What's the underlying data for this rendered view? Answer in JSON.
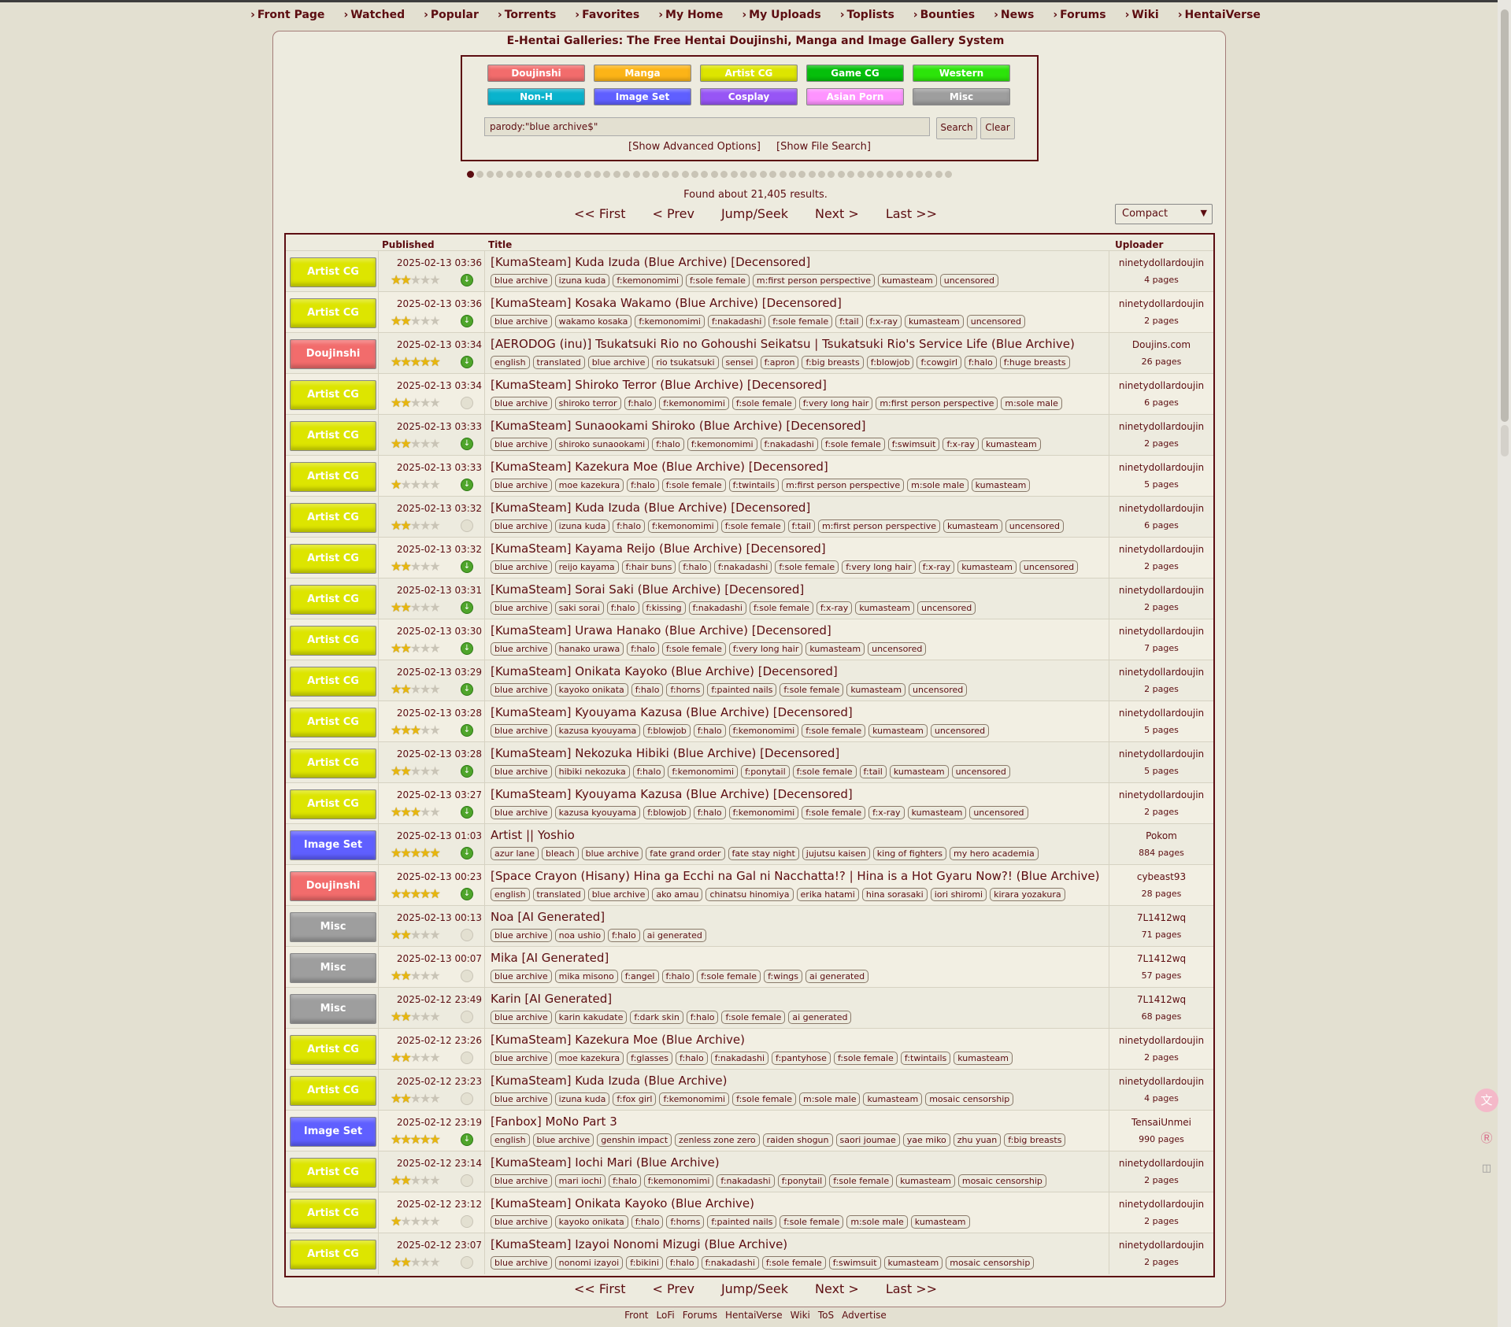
{
  "nav": [
    "Front Page",
    "Watched",
    "Popular",
    "Torrents",
    "Favorites",
    "My Home",
    "My Uploads",
    "Toplists",
    "Bounties",
    "News",
    "Forums",
    "Wiki",
    "HentaiVerse"
  ],
  "page_title": "E-Hentai Galleries: The Free Hentai Doujinshi, Manga and Image Gallery System",
  "categories": [
    {
      "label": "Doujinshi",
      "color": "#f26c6c"
    },
    {
      "label": "Manga",
      "color": "#fcb417"
    },
    {
      "label": "Artist CG",
      "color": "#dde500"
    },
    {
      "label": "Game CG",
      "color": "#05bf0b"
    },
    {
      "label": "Western",
      "color": "#2ce40a"
    },
    {
      "label": "Non-H",
      "color": "#09b3cd"
    },
    {
      "label": "Image Set",
      "color": "#5f5fff"
    },
    {
      "label": "Cosplay",
      "color": "#9755f5"
    },
    {
      "label": "Asian Porn",
      "color": "#fe93ff"
    },
    {
      "label": "Misc",
      "color": "#9e9e9e"
    }
  ],
  "search": {
    "value": "parody:\"blue archive$\"",
    "search_label": "Search",
    "clear_label": "Clear",
    "advanced": "[Show Advanced Options]",
    "file_search": "[Show File Search]"
  },
  "found": "Found about 21,405 results.",
  "pager": {
    "first": "<< First",
    "prev": "< Prev",
    "jump": "Jump/Seek",
    "next": "Next >",
    "last": "Last >>"
  },
  "view_mode": "Compact",
  "headers": {
    "published": "Published",
    "title": "Title",
    "uploader": "Uploader"
  },
  "rows": [
    {
      "cat": "Artist CG",
      "date": "2025-02-13 03:36",
      "stars": 2,
      "dl": true,
      "title": "[KumaSteam] Kuda Izuda (Blue Archive) [Decensored]",
      "tags": [
        "blue archive",
        "izuna kuda",
        "f:kemonomimi",
        "f:sole female",
        "m:first person perspective",
        "kumasteam",
        "uncensored"
      ],
      "uploader": "ninetydollardoujin",
      "pages": "4 pages"
    },
    {
      "cat": "Artist CG",
      "date": "2025-02-13 03:36",
      "stars": 2,
      "dl": true,
      "title": "[KumaSteam] Kosaka Wakamo (Blue Archive) [Decensored]",
      "tags": [
        "blue archive",
        "wakamo kosaka",
        "f:kemonomimi",
        "f:nakadashi",
        "f:sole female",
        "f:tail",
        "f:x-ray",
        "kumasteam",
        "uncensored"
      ],
      "uploader": "ninetydollardoujin",
      "pages": "2 pages"
    },
    {
      "cat": "Doujinshi",
      "date": "2025-02-13 03:34",
      "stars": 5,
      "dl": true,
      "title": "[AERODOG (inu)] Tsukatsuki Rio no Gohoushi Seikatsu | Tsukatsuki Rio's Service Life (Blue Archive)",
      "tags": [
        "english",
        "translated",
        "blue archive",
        "rio tsukatsuki",
        "sensei",
        "f:apron",
        "f:big breasts",
        "f:blowjob",
        "f:cowgirl",
        "f:halo",
        "f:huge breasts"
      ],
      "uploader": "Doujins.com",
      "pages": "26 pages"
    },
    {
      "cat": "Artist CG",
      "date": "2025-02-13 03:34",
      "stars": 2,
      "dl": false,
      "title": "[KumaSteam] Shiroko Terror (Blue Archive) [Decensored]",
      "tags": [
        "blue archive",
        "shiroko terror",
        "f:halo",
        "f:kemonomimi",
        "f:sole female",
        "f:very long hair",
        "m:first person perspective",
        "m:sole male"
      ],
      "uploader": "ninetydollardoujin",
      "pages": "6 pages"
    },
    {
      "cat": "Artist CG",
      "date": "2025-02-13 03:33",
      "stars": 2,
      "dl": true,
      "title": "[KumaSteam] Sunaookami Shiroko (Blue Archive) [Decensored]",
      "tags": [
        "blue archive",
        "shiroko sunaookami",
        "f:halo",
        "f:kemonomimi",
        "f:nakadashi",
        "f:sole female",
        "f:swimsuit",
        "f:x-ray",
        "kumasteam"
      ],
      "uploader": "ninetydollardoujin",
      "pages": "2 pages"
    },
    {
      "cat": "Artist CG",
      "date": "2025-02-13 03:33",
      "stars": 1,
      "dl": true,
      "title": "[KumaSteam] Kazekura Moe (Blue Archive) [Decensored]",
      "tags": [
        "blue archive",
        "moe kazekura",
        "f:halo",
        "f:sole female",
        "f:twintails",
        "m:first person perspective",
        "m:sole male",
        "kumasteam"
      ],
      "uploader": "ninetydollardoujin",
      "pages": "5 pages"
    },
    {
      "cat": "Artist CG",
      "date": "2025-02-13 03:32",
      "stars": 2,
      "dl": false,
      "title": "[KumaSteam] Kuda Izuda (Blue Archive) [Decensored]",
      "tags": [
        "blue archive",
        "izuna kuda",
        "f:halo",
        "f:kemonomimi",
        "f:sole female",
        "f:tail",
        "m:first person perspective",
        "kumasteam",
        "uncensored"
      ],
      "uploader": "ninetydollardoujin",
      "pages": "6 pages"
    },
    {
      "cat": "Artist CG",
      "date": "2025-02-13 03:32",
      "stars": 2,
      "dl": true,
      "title": "[KumaSteam] Kayama Reijo (Blue Archive) [Decensored]",
      "tags": [
        "blue archive",
        "reijo kayama",
        "f:hair buns",
        "f:halo",
        "f:nakadashi",
        "f:sole female",
        "f:very long hair",
        "f:x-ray",
        "kumasteam",
        "uncensored"
      ],
      "uploader": "ninetydollardoujin",
      "pages": "2 pages"
    },
    {
      "cat": "Artist CG",
      "date": "2025-02-13 03:31",
      "stars": 2,
      "dl": true,
      "title": "[KumaSteam] Sorai Saki (Blue Archive) [Decensored]",
      "tags": [
        "blue archive",
        "saki sorai",
        "f:halo",
        "f:kissing",
        "f:nakadashi",
        "f:sole female",
        "f:x-ray",
        "kumasteam",
        "uncensored"
      ],
      "uploader": "ninetydollardoujin",
      "pages": "2 pages"
    },
    {
      "cat": "Artist CG",
      "date": "2025-02-13 03:30",
      "stars": 2,
      "dl": true,
      "title": "[KumaSteam] Urawa Hanako (Blue Archive) [Decensored]",
      "tags": [
        "blue archive",
        "hanako urawa",
        "f:halo",
        "f:sole female",
        "f:very long hair",
        "kumasteam",
        "uncensored"
      ],
      "uploader": "ninetydollardoujin",
      "pages": "7 pages"
    },
    {
      "cat": "Artist CG",
      "date": "2025-02-13 03:29",
      "stars": 2,
      "dl": true,
      "title": "[KumaSteam] Onikata Kayoko (Blue Archive) [Decensored]",
      "tags": [
        "blue archive",
        "kayoko onikata",
        "f:halo",
        "f:horns",
        "f:painted nails",
        "f:sole female",
        "kumasteam",
        "uncensored"
      ],
      "uploader": "ninetydollardoujin",
      "pages": "2 pages"
    },
    {
      "cat": "Artist CG",
      "date": "2025-02-13 03:28",
      "stars": 3,
      "dl": true,
      "title": "[KumaSteam] Kyouyama Kazusa (Blue Archive) [Decensored]",
      "tags": [
        "blue archive",
        "kazusa kyouyama",
        "f:blowjob",
        "f:halo",
        "f:kemonomimi",
        "f:sole female",
        "kumasteam",
        "uncensored"
      ],
      "uploader": "ninetydollardoujin",
      "pages": "5 pages"
    },
    {
      "cat": "Artist CG",
      "date": "2025-02-13 03:28",
      "stars": 2,
      "dl": true,
      "title": "[KumaSteam] Nekozuka Hibiki (Blue Archive) [Decensored]",
      "tags": [
        "blue archive",
        "hibiki nekozuka",
        "f:halo",
        "f:kemonomimi",
        "f:ponytail",
        "f:sole female",
        "f:tail",
        "kumasteam",
        "uncensored"
      ],
      "uploader": "ninetydollardoujin",
      "pages": "5 pages"
    },
    {
      "cat": "Artist CG",
      "date": "2025-02-13 03:27",
      "stars": 3,
      "dl": true,
      "title": "[KumaSteam] Kyouyama Kazusa (Blue Archive) [Decensored]",
      "tags": [
        "blue archive",
        "kazusa kyouyama",
        "f:blowjob",
        "f:halo",
        "f:kemonomimi",
        "f:sole female",
        "f:x-ray",
        "kumasteam",
        "uncensored"
      ],
      "uploader": "ninetydollardoujin",
      "pages": "2 pages"
    },
    {
      "cat": "Image Set",
      "date": "2025-02-13 01:03",
      "stars": 5,
      "dl": true,
      "title": "Artist || Yoshio",
      "tags": [
        "azur lane",
        "bleach",
        "blue archive",
        "fate grand order",
        "fate stay night",
        "jujutsu kaisen",
        "king of fighters",
        "my hero academia"
      ],
      "uploader": "Pokom",
      "pages": "884 pages"
    },
    {
      "cat": "Doujinshi",
      "date": "2025-02-13 00:23",
      "stars": 5,
      "dl": true,
      "title": "[Space Crayon (Hisany) Hina ga Ecchi na Gal ni Nacchatta!? | Hina is a Hot Gyaru Now?! (Blue Archive)",
      "tags": [
        "english",
        "translated",
        "blue archive",
        "ako amau",
        "chinatsu hinomiya",
        "erika hatami",
        "hina sorasaki",
        "iori shiromi",
        "kirara yozakura"
      ],
      "uploader": "cybeast93",
      "pages": "28 pages"
    },
    {
      "cat": "Misc",
      "date": "2025-02-13 00:13",
      "stars": 2,
      "dl": false,
      "title": "Noa [AI Generated]",
      "tags": [
        "blue archive",
        "noa ushio",
        "f:halo",
        "ai generated"
      ],
      "uploader": "7L1412wq",
      "pages": "71 pages"
    },
    {
      "cat": "Misc",
      "date": "2025-02-13 00:07",
      "stars": 2,
      "dl": false,
      "title": "Mika [AI Generated]",
      "tags": [
        "blue archive",
        "mika misono",
        "f:angel",
        "f:halo",
        "f:sole female",
        "f:wings",
        "ai generated"
      ],
      "uploader": "7L1412wq",
      "pages": "57 pages"
    },
    {
      "cat": "Misc",
      "date": "2025-02-12 23:49",
      "stars": 2,
      "dl": false,
      "title": "Karin [AI Generated]",
      "tags": [
        "blue archive",
        "karin kakudate",
        "f:dark skin",
        "f:halo",
        "f:sole female",
        "ai generated"
      ],
      "uploader": "7L1412wq",
      "pages": "68 pages"
    },
    {
      "cat": "Artist CG",
      "date": "2025-02-12 23:26",
      "stars": 2,
      "dl": false,
      "title": "[KumaSteam] Kazekura Moe (Blue Archive)",
      "tags": [
        "blue archive",
        "moe kazekura",
        "f:glasses",
        "f:halo",
        "f:nakadashi",
        "f:pantyhose",
        "f:sole female",
        "f:twintails",
        "kumasteam"
      ],
      "uploader": "ninetydollardoujin",
      "pages": "2 pages"
    },
    {
      "cat": "Artist CG",
      "date": "2025-02-12 23:23",
      "stars": 2,
      "dl": false,
      "title": "[KumaSteam] Kuda Izuda (Blue Archive)",
      "tags": [
        "blue archive",
        "izuna kuda",
        "f:fox girl",
        "f:kemonomimi",
        "f:sole female",
        "m:sole male",
        "kumasteam",
        "mosaic censorship"
      ],
      "uploader": "ninetydollardoujin",
      "pages": "4 pages"
    },
    {
      "cat": "Image Set",
      "date": "2025-02-12 23:19",
      "stars": 5,
      "dl": true,
      "title": "[Fanbox] MoNo Part 3",
      "tags": [
        "english",
        "blue archive",
        "genshin impact",
        "zenless zone zero",
        "raiden shogun",
        "saori joumae",
        "yae miko",
        "zhu yuan",
        "f:big breasts"
      ],
      "uploader": "TensaiUnmei",
      "pages": "990 pages"
    },
    {
      "cat": "Artist CG",
      "date": "2025-02-12 23:14",
      "stars": 2,
      "dl": false,
      "title": "[KumaSteam] Iochi Mari (Blue Archive)",
      "tags": [
        "blue archive",
        "mari iochi",
        "f:halo",
        "f:kemonomimi",
        "f:nakadashi",
        "f:ponytail",
        "f:sole female",
        "kumasteam",
        "mosaic censorship"
      ],
      "uploader": "ninetydollardoujin",
      "pages": "2 pages"
    },
    {
      "cat": "Artist CG",
      "date": "2025-02-12 23:12",
      "stars": 1,
      "dl": false,
      "title": "[KumaSteam] Onikata Kayoko (Blue Archive)",
      "tags": [
        "blue archive",
        "kayoko onikata",
        "f:halo",
        "f:horns",
        "f:painted nails",
        "f:sole female",
        "m:sole male",
        "kumasteam"
      ],
      "uploader": "ninetydollardoujin",
      "pages": "2 pages"
    },
    {
      "cat": "Artist CG",
      "date": "2025-02-12 23:07",
      "stars": 2,
      "dl": false,
      "title": "[KumaSteam] Izayoi Nonomi Mizugi (Blue Archive)",
      "tags": [
        "blue archive",
        "nonomi izayoi",
        "f:bikini",
        "f:halo",
        "f:nakadashi",
        "f:sole female",
        "f:swimsuit",
        "kumasteam",
        "mosaic censorship"
      ],
      "uploader": "ninetydollardoujin",
      "pages": "2 pages"
    }
  ],
  "footer": [
    "Front",
    "LoFi",
    "Forums",
    "HentaiVerse",
    "Wiki",
    "ToS",
    "Advertise"
  ]
}
